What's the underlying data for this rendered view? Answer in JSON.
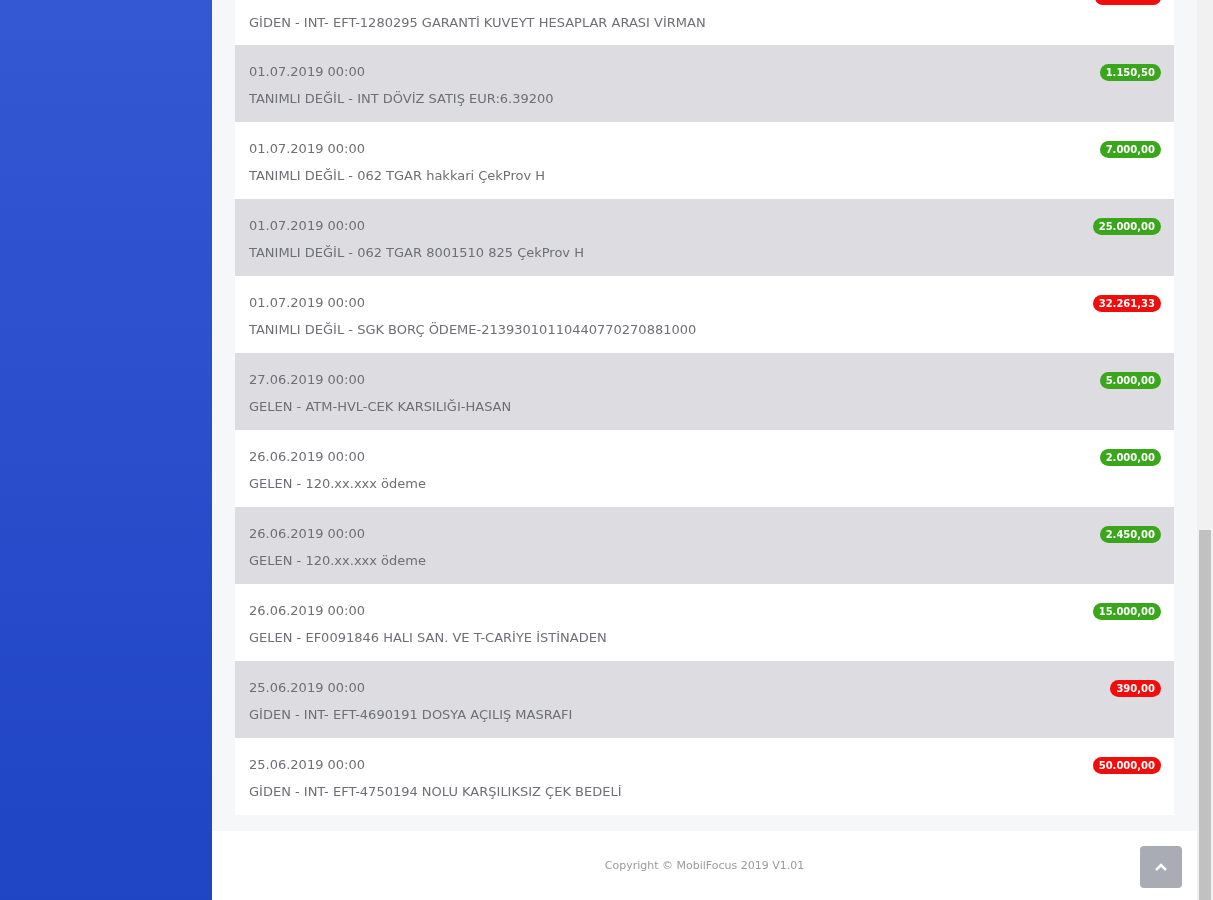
{
  "transactions": [
    {
      "description": "GİDEN - INT- EFT-1280295 GARANTİ KUVEYT HESAPLAR ARASI VİRMAN",
      "color": "#f20d0d"
    },
    {
      "date": "01.07.2019 00:00",
      "description": "TANIMLI DEĞİL - INT DÖVİZ SATIŞ EUR:6.39200",
      "amount": "1.150,50",
      "color": "#3aa61c"
    },
    {
      "date": "01.07.2019 00:00",
      "description": "TANIMLI DEĞİL - 062 TGAR hakkari ÇekProv H",
      "amount": "7.000,00",
      "color": "#3aa61c"
    },
    {
      "date": "01.07.2019 00:00",
      "description": "TANIMLI DEĞİL - 062 TGAR 8001510 825 ÇekProv H",
      "amount": "25.000,00",
      "color": "#3aa61c"
    },
    {
      "date": "01.07.2019 00:00",
      "description": "TANIMLI DEĞİL - SGK BORÇ ÖDEME-21393010110440770270881000",
      "amount": "32.261,33",
      "color": "#f20d0d"
    },
    {
      "date": "27.06.2019 00:00",
      "description": "GELEN - ATM-HVL-CEK KARSILIĞI-HASAN",
      "amount": "5.000,00",
      "color": "#3aa61c"
    },
    {
      "date": "26.06.2019 00:00",
      "description": "GELEN - 120.xx.xxx ödeme",
      "amount": "2.000,00",
      "color": "#3aa61c"
    },
    {
      "date": "26.06.2019 00:00",
      "description": "GELEN - 120.xx.xxx ödeme",
      "amount": "2.450,00",
      "color": "#3aa61c"
    },
    {
      "date": "26.06.2019 00:00",
      "description": "GELEN - EF0091846 HALI SAN. VE T-CARİYE İSTİNADEN",
      "amount": "15.000,00",
      "color": "#3aa61c"
    },
    {
      "date": "25.06.2019 00:00",
      "description": "GİDEN - INT- EFT-4690191 DOSYA AÇILIŞ MASRAFI",
      "amount": "390,00",
      "color": "#f20d0d"
    },
    {
      "date": "25.06.2019 00:00",
      "description": "GİDEN - INT- EFT-4750194 NOLU KARŞILIKSIZ ÇEK BEDELİ",
      "amount": "50.000,00",
      "color": "#f20d0d"
    }
  ],
  "footer": {
    "copyright": "Copyright © MobilFocus 2019 V1.01"
  }
}
